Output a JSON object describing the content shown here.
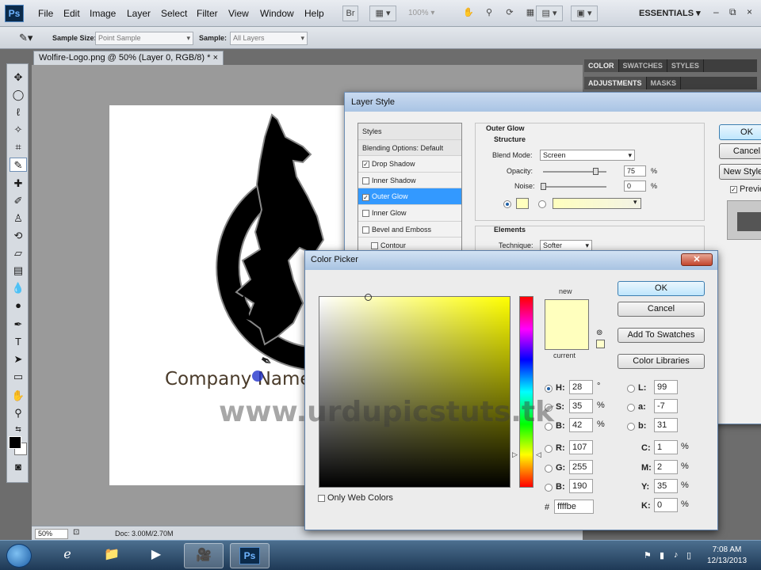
{
  "menubar": {
    "app_icon": "Ps",
    "items": [
      "File",
      "Edit",
      "Image",
      "Layer",
      "Select",
      "Filter",
      "View",
      "Window",
      "Help"
    ],
    "bridge_icon": "Br",
    "zoom": "100%",
    "workspace": "ESSENTIALS",
    "win_minimize": "–",
    "win_restore": "⧉",
    "win_close": "×"
  },
  "options": {
    "sample_size_label": "Sample Size:",
    "sample_size_value": "Point Sample",
    "sample_label": "Sample:",
    "sample_value": "All Layers"
  },
  "document": {
    "tab_title": "Wolfire-Logo.png @ 50% (Layer 0, RGB/8) *",
    "tab_close": "×",
    "company_text": "Company Name",
    "watermark": "www.urdupicstuts.tk",
    "status_zoom": "50%",
    "status_doc": "Doc: 3.00M/2.70M"
  },
  "panels": {
    "row1": [
      "COLOR",
      "SWATCHES",
      "STYLES"
    ],
    "row2": [
      "ADJUSTMENTS",
      "MASKS"
    ]
  },
  "layer_style": {
    "title": "Layer Style",
    "styles_header": "Styles",
    "blending": "Blending Options: Default",
    "items": [
      {
        "label": "Drop Shadow",
        "checked": true
      },
      {
        "label": "Inner Shadow",
        "checked": false
      },
      {
        "label": "Outer Glow",
        "checked": true,
        "selected": true
      },
      {
        "label": "Inner Glow",
        "checked": false
      },
      {
        "label": "Bevel and Emboss",
        "checked": false
      },
      {
        "label": "Contour",
        "checked": false
      }
    ],
    "section_title": "Outer Glow",
    "structure": "Structure",
    "blend_mode_label": "Blend Mode:",
    "blend_mode_value": "Screen",
    "opacity_label": "Opacity:",
    "opacity_value": "75",
    "noise_label": "Noise:",
    "noise_value": "0",
    "pct": "%",
    "elements": "Elements",
    "technique_label": "Technique:",
    "technique_value": "Softer",
    "ok": "OK",
    "cancel": "Cancel",
    "new_style": "New Style...",
    "preview": "Preview",
    "glow_color": "#ffffbe"
  },
  "color_picker": {
    "title": "Color Picker",
    "close": "✕",
    "new_label": "new",
    "current_label": "current",
    "new_color": "#ffffbe",
    "current_color": "#ffffbe",
    "ok": "OK",
    "cancel": "Cancel",
    "add_to_swatches": "Add To Swatches",
    "color_libraries": "Color Libraries",
    "only_web": "Only Web Colors",
    "hsb": [
      {
        "key": "H:",
        "value": "28",
        "unit": "°",
        "selected": true
      },
      {
        "key": "S:",
        "value": "35",
        "unit": "%",
        "selected": false
      },
      {
        "key": "B:",
        "value": "42",
        "unit": "%",
        "selected": false
      }
    ],
    "rgb": [
      {
        "key": "R:",
        "value": "107"
      },
      {
        "key": "G:",
        "value": "255"
      },
      {
        "key": "B:",
        "value": "190"
      }
    ],
    "lab": [
      {
        "key": "L:",
        "value": "99"
      },
      {
        "key": "a:",
        "value": "-7"
      },
      {
        "key": "b:",
        "value": "31"
      }
    ],
    "cmyk": [
      {
        "key": "C:",
        "value": "1",
        "unit": "%"
      },
      {
        "key": "M:",
        "value": "2",
        "unit": "%"
      },
      {
        "key": "Y:",
        "value": "35",
        "unit": "%"
      },
      {
        "key": "K:",
        "value": "0",
        "unit": "%"
      }
    ],
    "hex_key": "#",
    "hex_value": "ffffbe"
  },
  "taskbar": {
    "time": "7:08 AM",
    "date": "12/13/2013",
    "ps_label": "Ps"
  }
}
